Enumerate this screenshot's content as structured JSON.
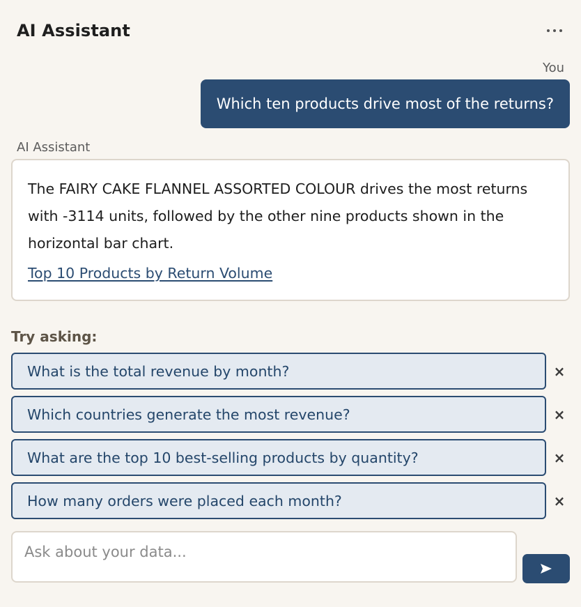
{
  "header": {
    "title": "AI Assistant",
    "menu_icon": "more-horizontal-icon"
  },
  "conversation": {
    "user": {
      "label": "You",
      "message": "Which ten products drive most of the returns?"
    },
    "assistant": {
      "label": "AI Assistant",
      "message": "The FAIRY CAKE FLANNEL ASSORTED COLOUR drives the most returns with -3114 units, followed by the other nine products shown in the horizontal bar chart.",
      "link": "Top 10 Products by Return Volume"
    }
  },
  "suggestions": {
    "label": "Try asking:",
    "items": [
      "What is the total revenue by month?",
      "Which countries generate the most revenue?",
      "What are the top 10 best-selling products by quantity?",
      "How many orders were placed each month?"
    ],
    "dismiss_glyph": "×"
  },
  "composer": {
    "placeholder": "Ask about your data...",
    "value": "",
    "send_icon": "send-arrow-icon"
  },
  "colors": {
    "primary": "#2b4c72",
    "background": "#f8f5f0",
    "suggestion_bg": "#e4eaf1",
    "border": "#ddd6cc"
  }
}
